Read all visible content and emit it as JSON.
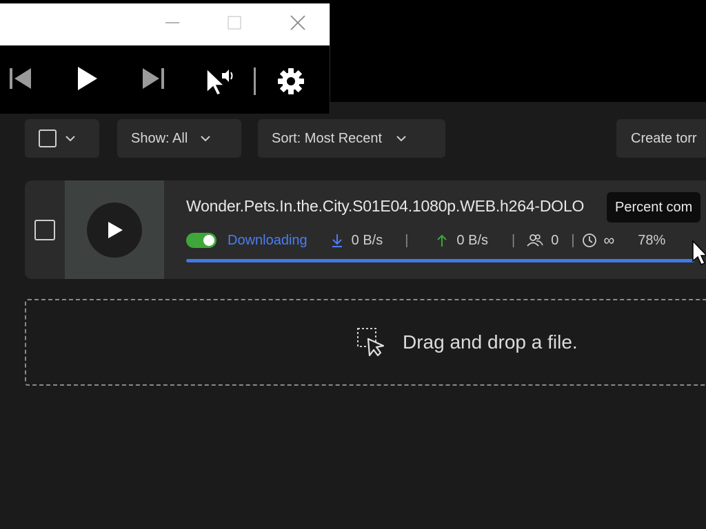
{
  "mini_player": {
    "controls": [
      {
        "name": "previous-track-icon"
      },
      {
        "name": "play-icon"
      },
      {
        "name": "next-track-icon"
      },
      {
        "name": "audio-cursor-icon"
      },
      {
        "name": "settings-gear-icon"
      }
    ]
  },
  "toolbar": {
    "show_label": "Show: All",
    "sort_label": "Sort: Most Recent",
    "create_label": "Create torr"
  },
  "torrent": {
    "title": "Wonder.Pets.In.the.City.S01E04.1080p.WEB.h264-DOLO",
    "status": "Downloading",
    "download_speed": "0 B/s",
    "upload_speed": "0 B/s",
    "peers": "0",
    "eta": "∞",
    "percent_label": "78%",
    "progress": 0.998
  },
  "tooltip": {
    "text": "Percent com"
  },
  "dropzone": {
    "text": "Drag and drop a file."
  },
  "colors": {
    "accent_blue": "#3f7ae6",
    "status_blue": "#4c7df2",
    "upload_green": "#3fa63b",
    "background": "#1b1b1b",
    "panel": "#2b2b2b"
  }
}
